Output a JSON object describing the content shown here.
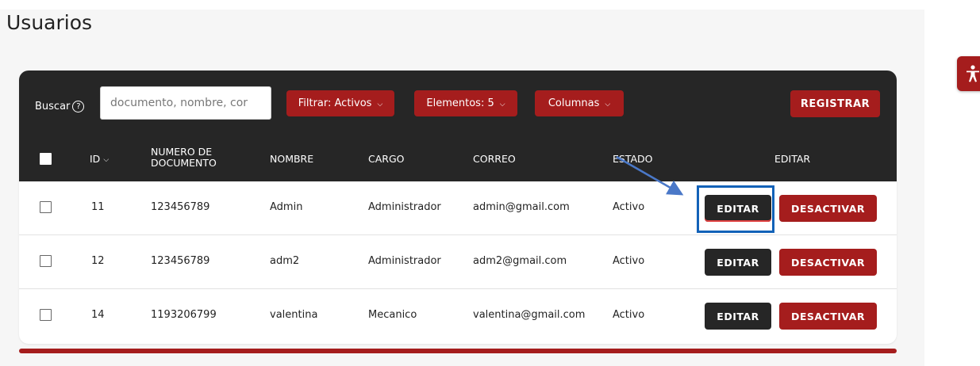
{
  "page": {
    "title": "Usuarios"
  },
  "toolbar": {
    "search_label": "Buscar",
    "help_glyph": "?",
    "search_placeholder": "documento, nombre, cor",
    "filter_label": "Filtrar: Activos",
    "elements_label": "Elementos: 5",
    "columns_label": "Columnas",
    "register_label": "REGISTRAR"
  },
  "table": {
    "headers": {
      "id": "ID",
      "document_line1": "NUMERO DE",
      "document_line2": "DOCUMENTO",
      "name": "NOMBRE",
      "role": "CARGO",
      "email": "CORREO",
      "status": "ESTADO",
      "edit": "EDITAR"
    },
    "rows": [
      {
        "id": "11",
        "document": "123456789",
        "name": "Admin",
        "role": "Administrador",
        "email": "admin@gmail.com",
        "status": "Activo",
        "edit": "EDITAR",
        "deactivate": "DESACTIVAR"
      },
      {
        "id": "12",
        "document": "123456789",
        "name": "adm2",
        "role": "Administrador",
        "email": "adm2@gmail.com",
        "status": "Activo",
        "edit": "EDITAR",
        "deactivate": "DESACTIVAR"
      },
      {
        "id": "14",
        "document": "1193206799",
        "name": "valentina",
        "role": "Mecanico",
        "email": "valentina@gmail.com",
        "status": "Activo",
        "edit": "EDITAR",
        "deactivate": "DESACTIVAR"
      }
    ]
  },
  "icons": {
    "accessibility": "accessibility-icon",
    "help": "help-circle-icon",
    "chevron": "chevron-down-icon"
  },
  "colors": {
    "brand_red": "#a51d1d",
    "header_dark": "#262626",
    "highlight_blue": "#1262b8"
  }
}
